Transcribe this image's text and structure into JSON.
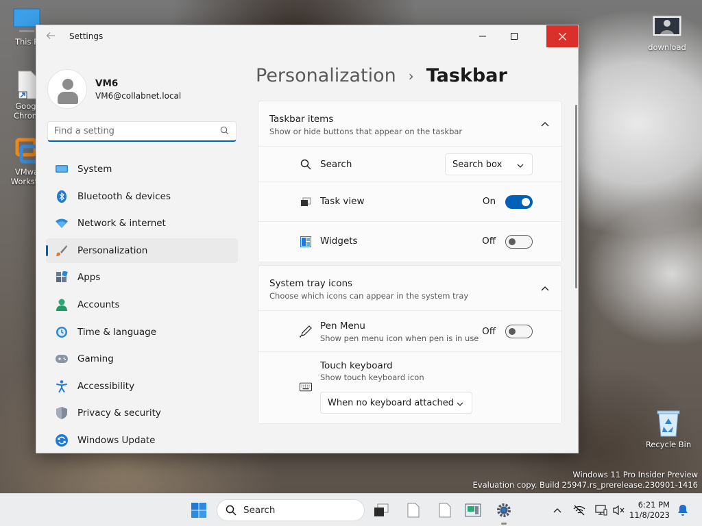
{
  "desktop": {
    "icons": {
      "this_pc": "This P",
      "chrome": "Googl\nChrom",
      "vmware": "VMwa\nWorksta",
      "download": "download",
      "recycle_bin": "Recycle Bin"
    },
    "watermark": {
      "line1": "Windows 11 Pro Insider Preview",
      "line2": "Evaluation copy. Build 25947.rs_prerelease.230901-1416"
    }
  },
  "window": {
    "title": "Settings",
    "controls": {
      "minimize": "—",
      "maximize": "☐",
      "close": "✕"
    }
  },
  "profile": {
    "name": "VM6",
    "email": "VM6@collabnet.local"
  },
  "search": {
    "placeholder": "Find a setting"
  },
  "nav": {
    "items": [
      {
        "label": "System",
        "icon": "monitor-icon"
      },
      {
        "label": "Bluetooth & devices",
        "icon": "bluetooth-icon"
      },
      {
        "label": "Network & internet",
        "icon": "wifi-icon"
      },
      {
        "label": "Personalization",
        "icon": "brush-icon",
        "active": true
      },
      {
        "label": "Apps",
        "icon": "apps-icon"
      },
      {
        "label": "Accounts",
        "icon": "person-icon"
      },
      {
        "label": "Time & language",
        "icon": "globe-clock-icon"
      },
      {
        "label": "Gaming",
        "icon": "gamepad-icon"
      },
      {
        "label": "Accessibility",
        "icon": "accessibility-icon"
      },
      {
        "label": "Privacy & security",
        "icon": "shield-icon"
      },
      {
        "label": "Windows Update",
        "icon": "update-icon"
      }
    ]
  },
  "breadcrumb": {
    "parent": "Personalization",
    "separator": "›",
    "current": "Taskbar"
  },
  "taskbar_items": {
    "title": "Taskbar items",
    "subtitle": "Show or hide buttons that appear on the taskbar",
    "search": {
      "label": "Search",
      "value": "Search box"
    },
    "task_view": {
      "label": "Task view",
      "state": "On"
    },
    "widgets": {
      "label": "Widgets",
      "state": "Off"
    }
  },
  "system_tray": {
    "title": "System tray icons",
    "subtitle": "Choose which icons can appear in the system tray",
    "pen_menu": {
      "label": "Pen Menu",
      "sub": "Show pen menu icon when pen is in use",
      "state": "Off"
    },
    "touch_keyboard": {
      "label": "Touch keyboard",
      "sub": "Show touch keyboard icon",
      "value": "When no keyboard attached"
    }
  },
  "taskbar": {
    "search_label": "Search",
    "time": "6:21 PM",
    "date": "11/8/2023"
  },
  "colors": {
    "accent": "#005fb8",
    "close": "#d9302c"
  }
}
